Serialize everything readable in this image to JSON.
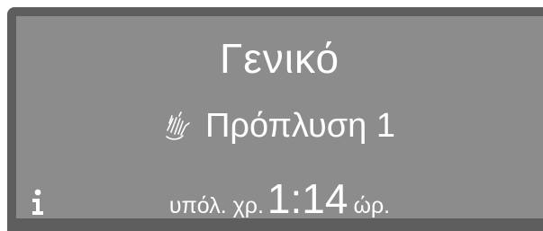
{
  "display": {
    "title": "Γενικό",
    "program": {
      "icon": "prewash-hands-icon",
      "label": "Πρόπλυση 1"
    },
    "remaining": {
      "prefix": "υπόλ. χρ.",
      "value": "1:14",
      "unit": "ώρ."
    },
    "info_icon": "info-icon"
  },
  "colors": {
    "frame": "#5e5e5e",
    "screen": "#8c8c8c",
    "text": "#ffffff"
  }
}
